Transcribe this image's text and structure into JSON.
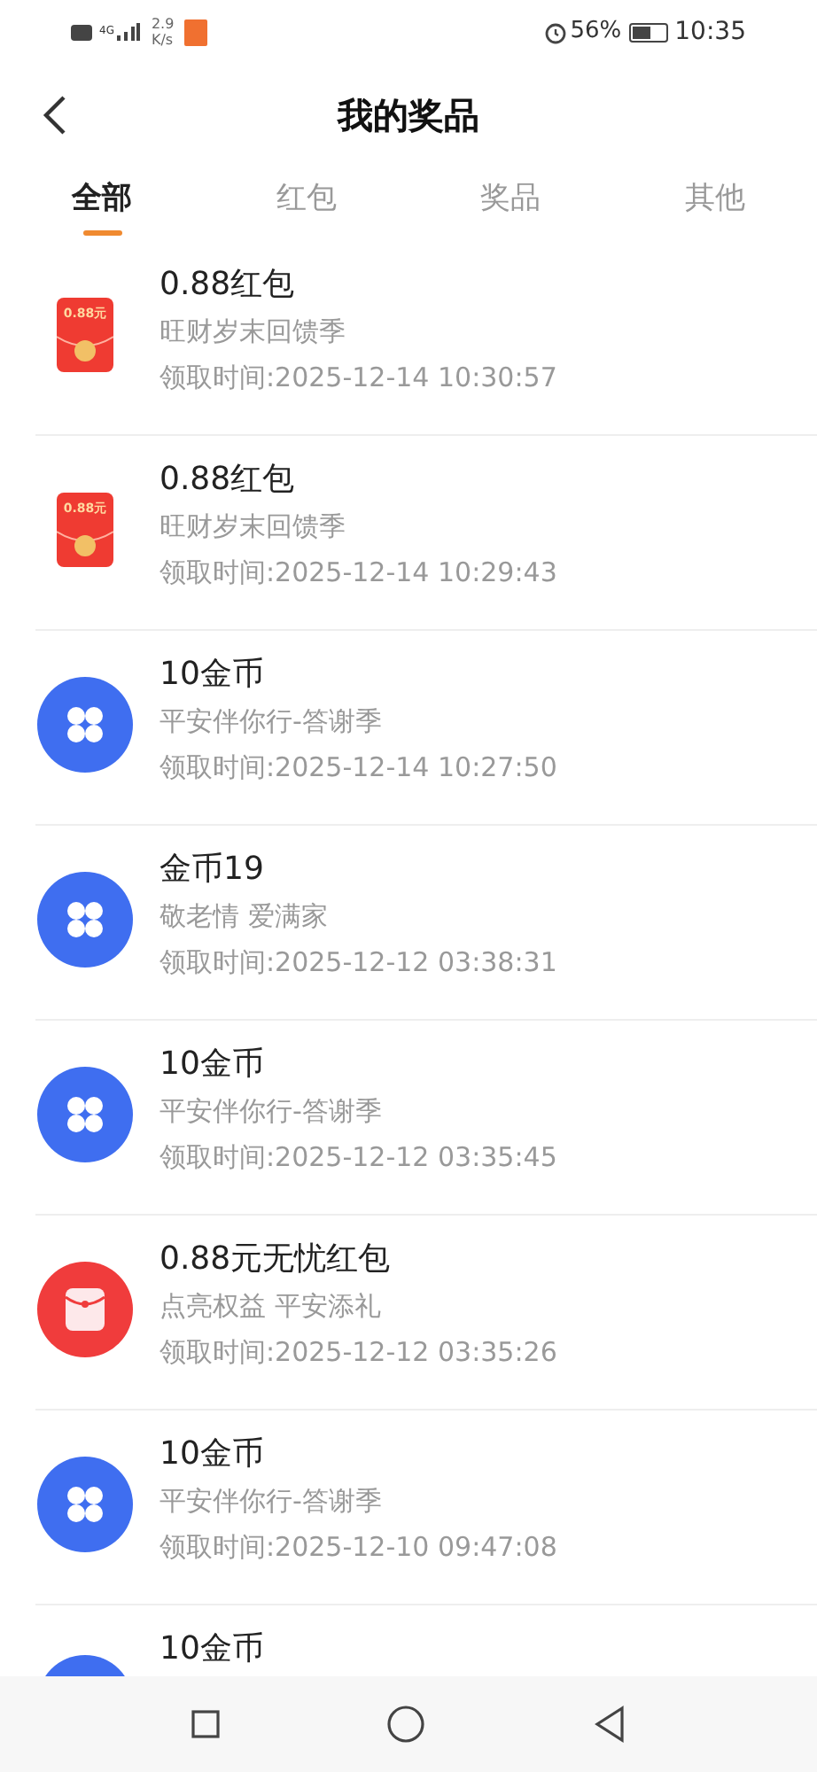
{
  "status_bar": {
    "speed": "2.9",
    "speed_unit": "K/s",
    "network": "4G",
    "battery_percent": "56%",
    "time": "10:35"
  },
  "header": {
    "title": "我的奖品"
  },
  "tabs": [
    {
      "label": "全部",
      "selected": true
    },
    {
      "label": "红包",
      "selected": false
    },
    {
      "label": "奖品",
      "selected": false
    },
    {
      "label": "其他",
      "selected": false
    }
  ],
  "prizes": [
    {
      "kind": "packet",
      "badge": "0.88元",
      "title": "0.88红包",
      "subtitle": "旺财岁末回馈季",
      "time": "领取时间:2025-12-14 10:30:57"
    },
    {
      "kind": "packet",
      "badge": "0.88元",
      "title": "0.88红包",
      "subtitle": "旺财岁末回馈季",
      "time": "领取时间:2025-12-14 10:29:43"
    },
    {
      "kind": "coin",
      "title": "10金币",
      "subtitle": "平安伴你行-答谢季",
      "time": "领取时间:2025-12-14 10:27:50"
    },
    {
      "kind": "coin",
      "title": "金币19",
      "subtitle": "敬老情 爱满家",
      "time": "领取时间:2025-12-12 03:38:31"
    },
    {
      "kind": "coin",
      "title": "10金币",
      "subtitle": "平安伴你行-答谢季",
      "time": "领取时间:2025-12-12 03:35:45"
    },
    {
      "kind": "gift",
      "title": "0.88元无忧红包",
      "subtitle": "点亮权益 平安添礼",
      "time": "领取时间:2025-12-12 03:35:26"
    },
    {
      "kind": "coin",
      "title": "10金币",
      "subtitle": "平安伴你行-答谢季",
      "time": "领取时间:2025-12-10 09:47:08"
    },
    {
      "kind": "coin",
      "title": "10金币"
    }
  ]
}
